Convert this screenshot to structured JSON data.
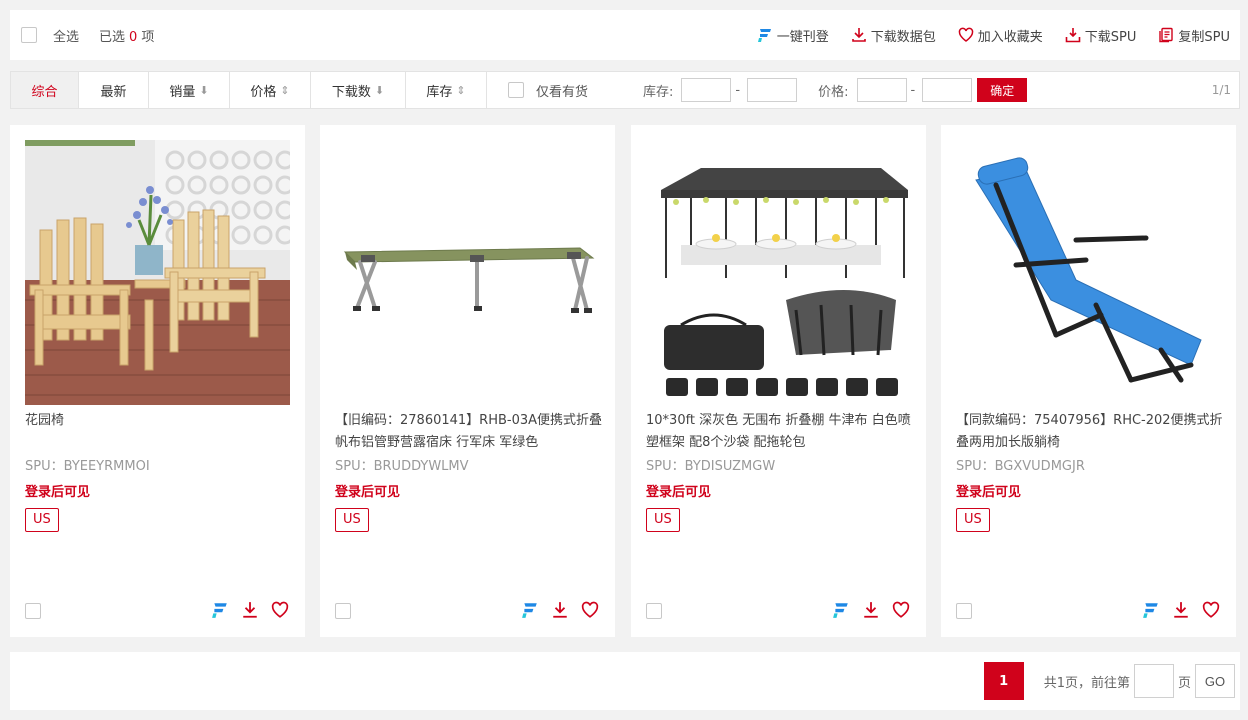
{
  "toolbar": {
    "select_all": "全选",
    "selected_prefix": "已选",
    "selected_count": "0",
    "selected_suffix": "项",
    "actions": [
      {
        "label": "一键刊登",
        "icon": "publish-icon"
      },
      {
        "label": "下载数据包",
        "icon": "download-icon"
      },
      {
        "label": "加入收藏夹",
        "icon": "heart-icon"
      },
      {
        "label": "下载SPU",
        "icon": "download-tray-icon"
      },
      {
        "label": "复制SPU",
        "icon": "copy-icon"
      }
    ]
  },
  "filters": {
    "tabs": [
      {
        "label": "综合",
        "active": true,
        "arrow": ""
      },
      {
        "label": "最新",
        "active": false,
        "arrow": ""
      },
      {
        "label": "销量",
        "active": false,
        "arrow": "⬇"
      },
      {
        "label": "价格",
        "active": false,
        "arrow": "⇕"
      },
      {
        "label": "下载数",
        "active": false,
        "arrow": "⬇"
      },
      {
        "label": "库存",
        "active": false,
        "arrow": "⇕"
      }
    ],
    "in_stock_label": "仅看有货",
    "stock_label": "库存:",
    "price_label": "价格:",
    "range_separator": "-",
    "confirm_label": "确定",
    "page_count": "1/1"
  },
  "products": [
    {
      "title": "花园椅",
      "spu": "SPU：BYEEYRMMOI",
      "login_note": "登录后可见",
      "tag": "US"
    },
    {
      "title": "【旧编码：27860141】RHB-03A便携式折叠帆布铝管野营露宿床 行军床 军绿色",
      "spu": "SPU：BRUDDYWLMV",
      "login_note": "登录后可见",
      "tag": "US"
    },
    {
      "title": "10*30ft 深灰色 无围布 折叠棚 牛津布 白色喷塑框架 配8个沙袋 配拖轮包",
      "spu": "SPU：BYDISUZMGW",
      "login_note": "登录后可见",
      "tag": "US"
    },
    {
      "title": "【同款编码：75407956】RHC-202便携式折叠两用加长版躺椅",
      "spu": "SPU：BGXVUDMGJR",
      "login_note": "登录后可见",
      "tag": "US"
    }
  ],
  "pagination": {
    "current": "1",
    "total_text": "共1页，前往第",
    "page_unit": "页",
    "go_label": "GO"
  },
  "colors": {
    "accent": "#d0021b",
    "publish_blue": "#1e88e5",
    "publish_teal": "#26c6da"
  }
}
